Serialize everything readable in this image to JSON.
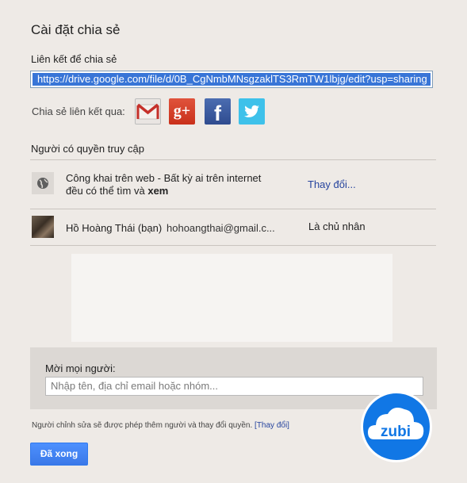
{
  "dialog": {
    "title": "Cài đặt chia sẻ",
    "link_section_label": "Liên kết để chia sẻ",
    "link_url": "https://drive.google.com/file/d/0B_CgNmbMNsgzaklTS3RmTW1lbjg/edit?usp=sharing",
    "share_via_label": "Chia sẻ liên kết qua:",
    "social_icons": [
      "gmail-icon",
      "google-plus-icon",
      "facebook-icon",
      "twitter-icon"
    ],
    "access_section_label": "Người có quyền truy cập"
  },
  "access_rows": [
    {
      "icon": "globe-icon",
      "line1": "Công khai trên web - Bất kỳ ai trên internet",
      "line2_prefix": "đều có thể tìm và ",
      "line2_bold": "xem",
      "action": "Thay đổi..."
    },
    {
      "icon": "avatar",
      "name": "Hồ Hoàng Thái (bạn)",
      "email": "hohoangthai@gmail.c...",
      "role": "Là chủ nhân"
    }
  ],
  "invite": {
    "label": "Mời mọi người:",
    "placeholder": "Nhập tên, địa chỉ email hoặc nhóm..."
  },
  "footer": {
    "note": "Người chỉnh sửa sẽ được phép thêm người và thay đổi quyền.",
    "change_link": "[Thay đổi]",
    "done_button": "Đã xong"
  },
  "watermark": {
    "text": "zubi"
  },
  "colors": {
    "background": "#eeeae6",
    "link_selection": "#3875d7",
    "link_text": "#26449e",
    "done_button": "#4d90fe",
    "gmail_red": "#c5302a",
    "google_plus_red": "#d6452d",
    "facebook_blue": "#3b5998",
    "twitter_blue": "#3ec1ea",
    "zubi_blue": "#1177e5"
  }
}
